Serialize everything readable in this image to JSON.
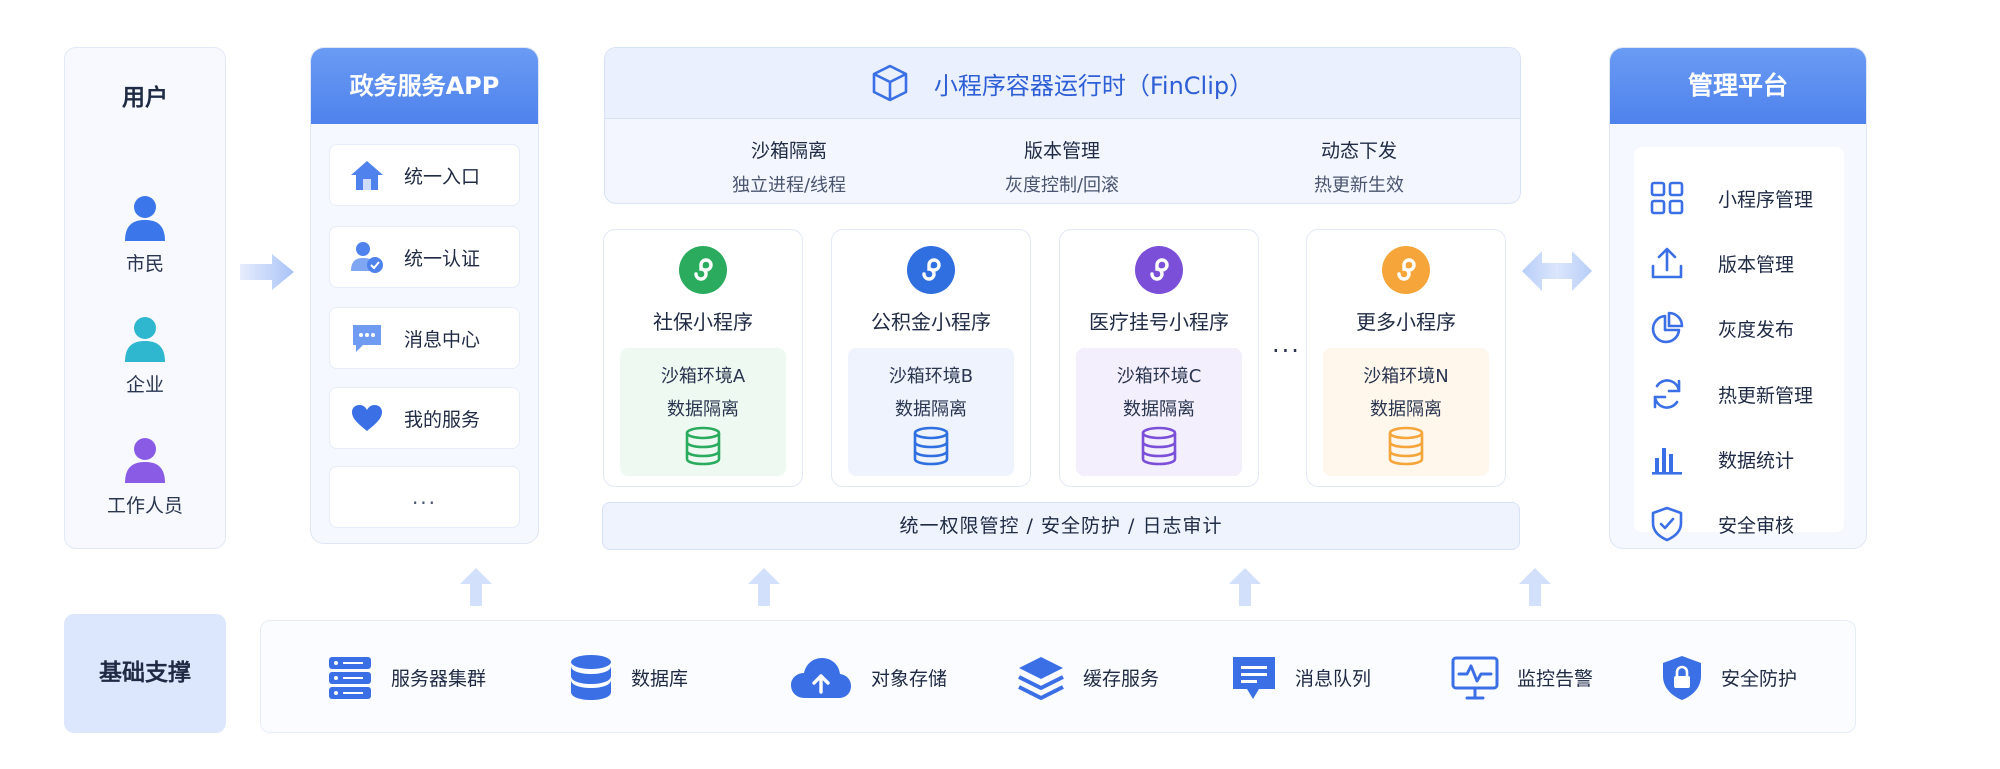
{
  "users": {
    "title": "用户",
    "items": [
      {
        "label": "市民",
        "icon": "person-icon",
        "color": "#3b76ea"
      },
      {
        "label": "企业",
        "icon": "person-icon",
        "color": "#2fb7cf"
      },
      {
        "label": "工作人员",
        "icon": "person-icon",
        "color": "#8a5ce6"
      }
    ]
  },
  "app": {
    "title": "政务服务APP",
    "items": [
      {
        "label": "统一入口",
        "icon": "home-icon"
      },
      {
        "label": "统一认证",
        "icon": "user-verify-icon"
      },
      {
        "label": "消息中心",
        "icon": "chat-icon"
      },
      {
        "label": "我的服务",
        "icon": "heart-icon"
      }
    ],
    "more": "..."
  },
  "runtime": {
    "title": "小程序容器运行时（FinClip）",
    "icon": "cube-icon",
    "features": [
      {
        "name": "沙箱隔离",
        "desc": "独立进程/线程"
      },
      {
        "name": "版本管理",
        "desc": "灰度控制/回滚"
      },
      {
        "name": "动态下发",
        "desc": "热更新生效"
      }
    ]
  },
  "mini_programs": [
    {
      "name": "社保小程序",
      "sandbox": "沙箱环境A",
      "isolation": "数据隔离",
      "color": "#2bab5e",
      "sandbox_bg": "#eef9f1"
    },
    {
      "name": "公积金小程序",
      "sandbox": "沙箱环境B",
      "isolation": "数据隔离",
      "color": "#2f6fe0",
      "sandbox_bg": "#eef3fe"
    },
    {
      "name": "医疗挂号小程序",
      "sandbox": "沙箱环境C",
      "isolation": "数据隔离",
      "color": "#7b4fd8",
      "sandbox_bg": "#f3effd"
    },
    {
      "name": "更多小程序",
      "sandbox": "沙箱环境N",
      "isolation": "数据隔离",
      "color": "#f5a53a",
      "sandbox_bg": "#fff7ec"
    }
  ],
  "mini_dots": "...",
  "unified_bar": "统一权限管控 / 安全防护 / 日志审计",
  "management": {
    "title": "管理平台",
    "items": [
      {
        "label": "小程序管理",
        "icon": "grid-icon"
      },
      {
        "label": "版本管理",
        "icon": "upload-icon"
      },
      {
        "label": "灰度发布",
        "icon": "pie-chart-icon"
      },
      {
        "label": "热更新管理",
        "icon": "refresh-icon"
      },
      {
        "label": "数据统计",
        "icon": "bar-chart-icon"
      },
      {
        "label": "安全审核",
        "icon": "shield-check-icon"
      }
    ]
  },
  "infra": {
    "title": "基础支撑",
    "items": [
      {
        "label": "服务器集群",
        "icon": "server-icon"
      },
      {
        "label": "数据库",
        "icon": "database-icon"
      },
      {
        "label": "对象存储",
        "icon": "cloud-upload-icon"
      },
      {
        "label": "缓存服务",
        "icon": "layers-icon"
      },
      {
        "label": "消息队列",
        "icon": "message-queue-icon"
      },
      {
        "label": "监控告警",
        "icon": "monitor-icon"
      },
      {
        "label": "安全防护",
        "icon": "shield-lock-icon"
      }
    ]
  },
  "colors": {
    "accent": "#3b6fe6",
    "header_blue": "#5b8def",
    "arrow_light": "#c9d8fb"
  }
}
